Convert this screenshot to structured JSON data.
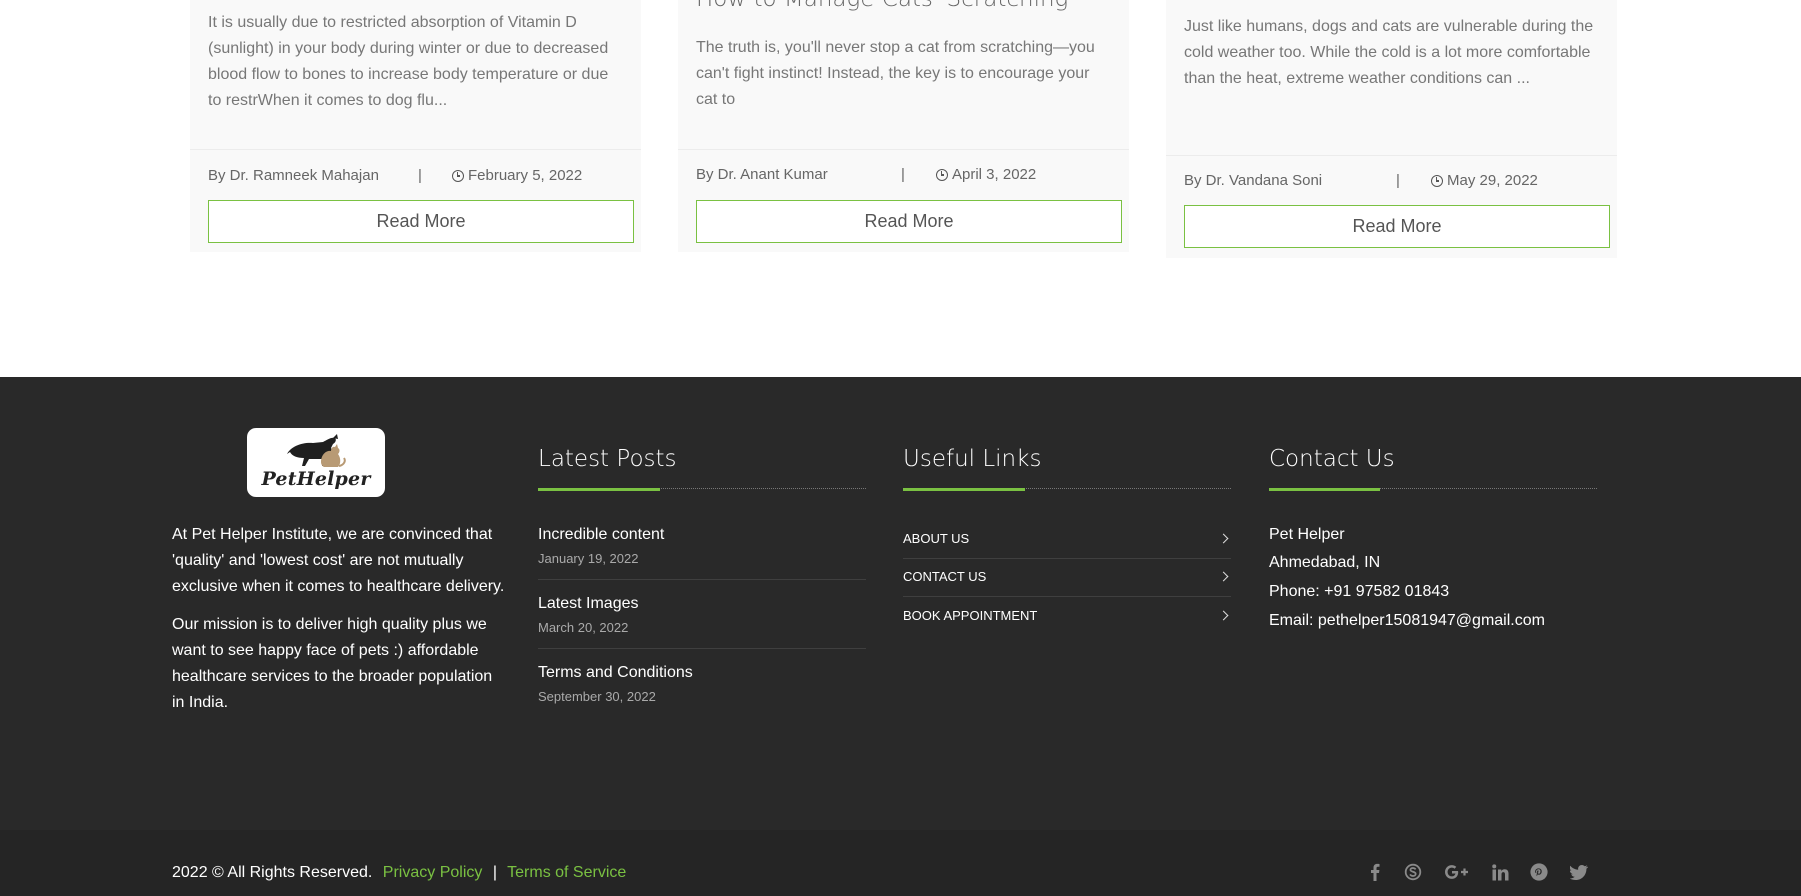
{
  "cards": [
    {
      "title": "",
      "excerpt": "It is usually due to restricted absorption of Vitamin D (sunlight) in your body during winter or due to decreased blood flow to bones to increase body temperature or due to restrWhen it comes to dog flu...",
      "author": "By Dr. Ramneek Mahajan",
      "separator": "|",
      "date": "February 5, 2022",
      "read_more": "Read More"
    },
    {
      "title": "How to Manage Cats' Scratching",
      "excerpt": "The truth is, you'll never stop a cat from scratching—you can't fight instinct! Instead, the key is to encourage your cat to",
      "author": "By Dr. Anant Kumar",
      "separator": "|",
      "date": "April 3, 2022",
      "read_more": "Read More"
    },
    {
      "title": "",
      "excerpt": "Just like humans, dogs and cats are vulnerable during the cold weather too. While the cold is a lot more comfortable than the heat, extreme weather conditions can ...",
      "author": "By Dr. Vandana Soni",
      "separator": "|",
      "date": "May 29, 2022",
      "read_more": "Read More"
    }
  ],
  "footer": {
    "logo_text": "PetHelper",
    "about": [
      "At Pet Helper Institute, we are convinced that 'quality' and 'lowest cost' are not mutually exclusive when it comes to healthcare delivery.",
      "Our mission is to deliver high quality plus we want to see happy face of pets :) affordable healthcare services to the broader population in India."
    ],
    "latest_posts": {
      "title": "Latest Posts",
      "items": [
        {
          "title": "Incredible content",
          "date": "January 19, 2022"
        },
        {
          "title": "Latest Images",
          "date": "March 20, 2022"
        },
        {
          "title": "Terms and Conditions",
          "date": "September 30, 2022"
        }
      ]
    },
    "useful_links": {
      "title": "Useful Links",
      "items": [
        {
          "label": "ABOUT US"
        },
        {
          "label": "CONTACT US"
        },
        {
          "label": "BOOK APPOINTMENT"
        }
      ]
    },
    "contact": {
      "title": "Contact Us",
      "name": "Pet Helper",
      "city": "Ahmedabad, IN",
      "phone": "Phone: +91 97582 01843",
      "email": "Email: pethelper15081947@gmail.com"
    }
  },
  "bottom_bar": {
    "copyright": "2022 © All Rights Reserved.",
    "privacy": "Privacy Policy",
    "separator": "|",
    "terms": "Terms of Service",
    "social_icons": [
      "facebook-icon",
      "skype-icon",
      "google-plus-icon",
      "linkedin-icon",
      "pinterest-icon",
      "twitter-icon"
    ]
  },
  "colors": {
    "accent": "#7ac142",
    "footer_bg": "#292929",
    "bottom_bar_bg": "#252525",
    "card_bg": "#f9f9f9"
  }
}
